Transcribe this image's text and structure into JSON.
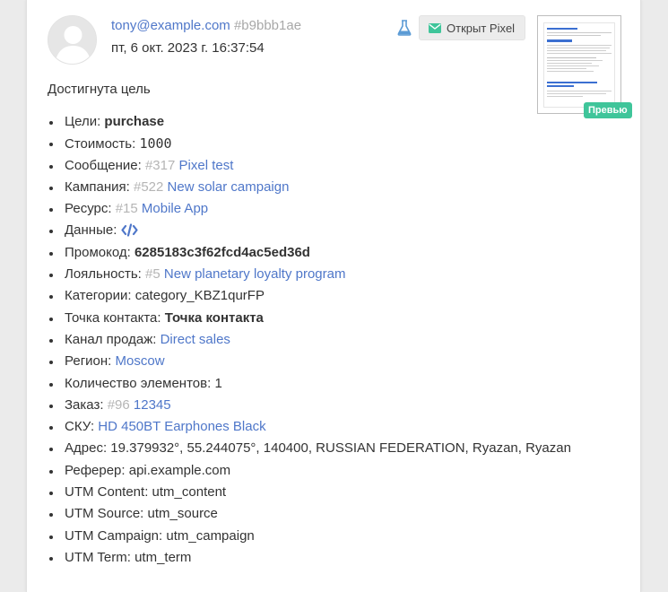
{
  "header": {
    "email": "tony@example.com",
    "hash": "#b9bbb1ae",
    "date": "пт, 6 окт. 2023 г. 16:37:54",
    "open_button_label": "Открыт Pixel",
    "preview_badge": "Превью"
  },
  "summary": "Достигнута цель",
  "fields": {
    "goals": {
      "label": "Цели:",
      "value": "purchase"
    },
    "cost": {
      "label": "Стоимость:",
      "value": "1000"
    },
    "message": {
      "label": "Сообщение:",
      "id": "#317",
      "value": "Pixel test"
    },
    "campaign": {
      "label": "Кампания:",
      "id": "#522",
      "value": "New solar campaign"
    },
    "resource": {
      "label": "Ресурс:",
      "id": "#15",
      "value": "Mobile App"
    },
    "data": {
      "label": "Данные:"
    },
    "promo": {
      "label": "Промокод:",
      "value": "6285183c3f62fcd4ac5ed36d"
    },
    "loyalty": {
      "label": "Лояльность:",
      "id": "#5",
      "value": "New planetary loyalty program"
    },
    "categories": {
      "label": "Категории:",
      "value": "category_KBZ1qurFP"
    },
    "contact_point": {
      "label": "Точка контакта:",
      "value": "Точка контакта"
    },
    "sales_channel": {
      "label": "Канал продаж:",
      "value": "Direct sales"
    },
    "region": {
      "label": "Регион:",
      "value": "Moscow"
    },
    "items_count": {
      "label": "Количество элементов:",
      "value": "1"
    },
    "order": {
      "label": "Заказ:",
      "id": "#96",
      "value": "12345"
    },
    "sku": {
      "label": "СКУ:",
      "value": "HD 450BT Earphones Black"
    },
    "address": {
      "label": "Адрес:",
      "value": "19.379932°, 55.244075°, 140400, RUSSIAN FEDERATION, Ryazan, Ryazan"
    },
    "referrer": {
      "label": "Реферер:",
      "value": "api.example.com"
    },
    "utm_content": {
      "label": "UTM Content:",
      "value": "utm_content"
    },
    "utm_source": {
      "label": "UTM Source:",
      "value": "utm_source"
    },
    "utm_campaign": {
      "label": "UTM Campaign:",
      "value": "utm_campaign"
    },
    "utm_term": {
      "label": "UTM Term:",
      "value": "utm_term"
    }
  },
  "colors": {
    "link": "#4f77c9",
    "dim": "#b5b5b5",
    "accent_green": "#3fc59a",
    "test_icon": "#5b9bd5"
  },
  "icons": {
    "test": "flask-icon",
    "open": "envelope-icon",
    "data": "code-icon"
  }
}
